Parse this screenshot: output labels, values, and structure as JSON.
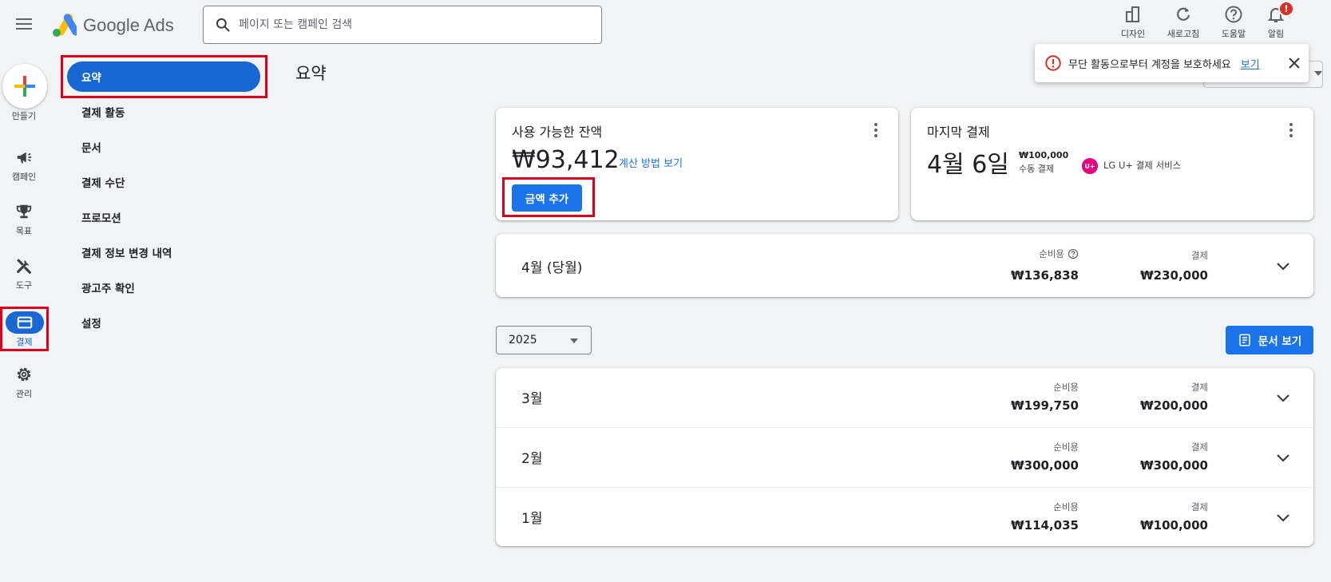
{
  "app": {
    "name": "Google Ads"
  },
  "search": {
    "placeholder": "페이지 또는 캠페인 검색",
    "value": ""
  },
  "top_actions": [
    {
      "label": "디자인",
      "icon": "design-icon"
    },
    {
      "label": "새로고침",
      "icon": "refresh-icon"
    },
    {
      "label": "도움말",
      "icon": "help-icon"
    },
    {
      "label": "알림",
      "icon": "bell-icon",
      "badge": "!"
    }
  ],
  "rail": {
    "create": "만들기",
    "items": [
      {
        "label": "캠페인",
        "icon": "megaphone-icon"
      },
      {
        "label": "목표",
        "icon": "trophy-icon"
      },
      {
        "label": "도구",
        "icon": "tools-icon"
      },
      {
        "label": "결제",
        "icon": "credit-card-icon",
        "active": true
      },
      {
        "label": "관리",
        "icon": "gear-icon"
      }
    ]
  },
  "nav": {
    "items": [
      {
        "label": "요약",
        "active": true
      },
      {
        "label": "결제 활동"
      },
      {
        "label": "문서"
      },
      {
        "label": "결제 수단"
      },
      {
        "label": "프로모션"
      },
      {
        "label": "결제 정보 변경 내역"
      },
      {
        "label": "광고주 확인"
      },
      {
        "label": "설정"
      }
    ]
  },
  "page": {
    "title": "요약"
  },
  "toast": {
    "message": "무단 활동으로부터 계정을 보호하세요",
    "action": "보기"
  },
  "balance_card": {
    "title": "사용 가능한 잔액",
    "amount": "₩93,412",
    "calc_link": "계산 방법 보기",
    "add_button": "금액 추가"
  },
  "last_payment_card": {
    "title": "마지막 결제",
    "date": "4월 6일",
    "amount": "₩100,000",
    "method": "수동 결제",
    "provider_logo": "U+",
    "provider": "LG U+ 결제 서비스"
  },
  "current_month": {
    "label": "4월 (당월)",
    "cost_head": "순비용",
    "cost": "₩136,838",
    "pay_head": "결제",
    "pay": "₩230,000"
  },
  "year_select": {
    "value": "2025"
  },
  "docs_button": "문서 보기",
  "months": [
    {
      "label": "3월",
      "cost_head": "순비용",
      "cost": "₩199,750",
      "pay_head": "결제",
      "pay": "₩200,000"
    },
    {
      "label": "2월",
      "cost_head": "순비용",
      "cost": "₩300,000",
      "pay_head": "결제",
      "pay": "₩300,000"
    },
    {
      "label": "1월",
      "cost_head": "순비용",
      "cost": "₩114,035",
      "pay_head": "결제",
      "pay": "₩100,000"
    }
  ],
  "colors": {
    "primary": "#1a73e8",
    "active_nav": "#1967d2",
    "highlight": "#e0001b",
    "error": "#d93025"
  }
}
